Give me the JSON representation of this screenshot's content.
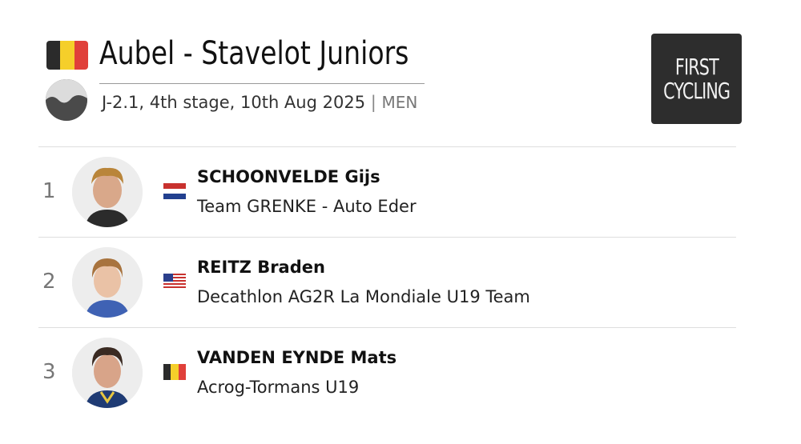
{
  "race": {
    "title": "Aubel - Stavelot Juniors",
    "category_stage": "J-2.1, 4th stage, 10th Aug 2025",
    "separator": "|",
    "gender": "MEN",
    "country_flag_icon": "belgium-flag-icon",
    "profile_icon": "hilly-terrain-icon"
  },
  "logo": {
    "line1": "First",
    "line2": "Cycling"
  },
  "colors": {
    "logo_bg": "#2d2d2d",
    "divider": "#dedede",
    "rank": "#777777"
  },
  "results": [
    {
      "rank": "1",
      "name": "SCHOONVELDE Gijs",
      "team": "Team GRENKE - Auto Eder",
      "nationality_icon": "netherlands-flag-icon"
    },
    {
      "rank": "2",
      "name": "REITZ Braden",
      "team": "Decathlon AG2R La Mondiale U19 Team",
      "nationality_icon": "usa-flag-icon"
    },
    {
      "rank": "3",
      "name": "VANDEN EYNDE Mats",
      "team": "Acrog-Tormans U19",
      "nationality_icon": "belgium-flag-icon"
    }
  ]
}
